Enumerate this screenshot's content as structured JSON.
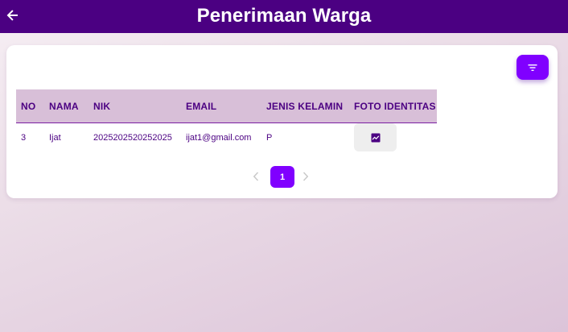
{
  "appbar": {
    "title": "Penerimaan Warga",
    "back_icon": "arrow-left-icon",
    "background_color": "#4b0082"
  },
  "toolbar": {
    "filter_icon": "filter-icon",
    "accent_color": "#8000ff"
  },
  "table": {
    "columns": [
      "NO",
      "NAMA",
      "NIK",
      "EMAIL",
      "JENIS KELAMIN",
      "FOTO IDENTITAS"
    ],
    "rows": [
      {
        "no": "3",
        "nama": "Ijat",
        "nik": "2025202520252025",
        "email": "ijat1@gmail.com",
        "jenis_kelamin": "P",
        "foto_icon": "image-icon"
      }
    ],
    "header_color": "#d8bfd8"
  },
  "pagination": {
    "current_page": "1",
    "prev_icon": "chevron-left-icon",
    "next_icon": "chevron-right-icon"
  }
}
